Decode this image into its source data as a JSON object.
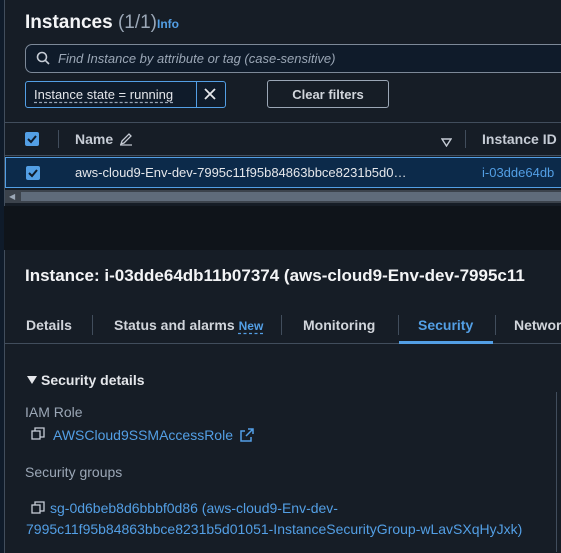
{
  "header": {
    "title": "Instances",
    "count": "(1/1)",
    "info": "Info"
  },
  "search": {
    "placeholder": "Find Instance by attribute or tag (case-sensitive)"
  },
  "filter_token": "Instance state = running",
  "clear_filters": "Clear filters",
  "table": {
    "columns": [
      "Name",
      "Instance ID"
    ],
    "rows": [
      {
        "name": "aws-cloud9-Env-dev-7995c11f95b84863bbce8231b5d0…",
        "instance_id": "i-03dde64db"
      }
    ]
  },
  "detail": {
    "title": "Instance: i-03dde64db11b07374 (aws-cloud9-Env-dev-7995c11",
    "tabs": [
      "Details",
      "Status and alarms",
      "Monitoring",
      "Security",
      "Networ"
    ],
    "new_badge": "New",
    "active_tab": "Security",
    "section_title": "Security details",
    "iam_role_label": "IAM Role",
    "iam_role_value": "AWSCloud9SSMAccessRole",
    "security_groups_label": "Security groups",
    "security_group_line1": "sg-0d6beb8d6bbbf0d86 (aws-cloud9-Env-dev-",
    "security_group_line2": "7995c11f95b84863bbce8231b5d01051-InstanceSecurityGroup-wLavSXqHyJxk)"
  },
  "colors": {
    "accent": "#539fe5",
    "background": "#161d26"
  },
  "icons": [
    "search-icon",
    "close-icon",
    "edit-icon",
    "sort-down-icon",
    "copy-icon",
    "external-link-icon",
    "caret-down-icon",
    "checkbox-checked-icon"
  ]
}
